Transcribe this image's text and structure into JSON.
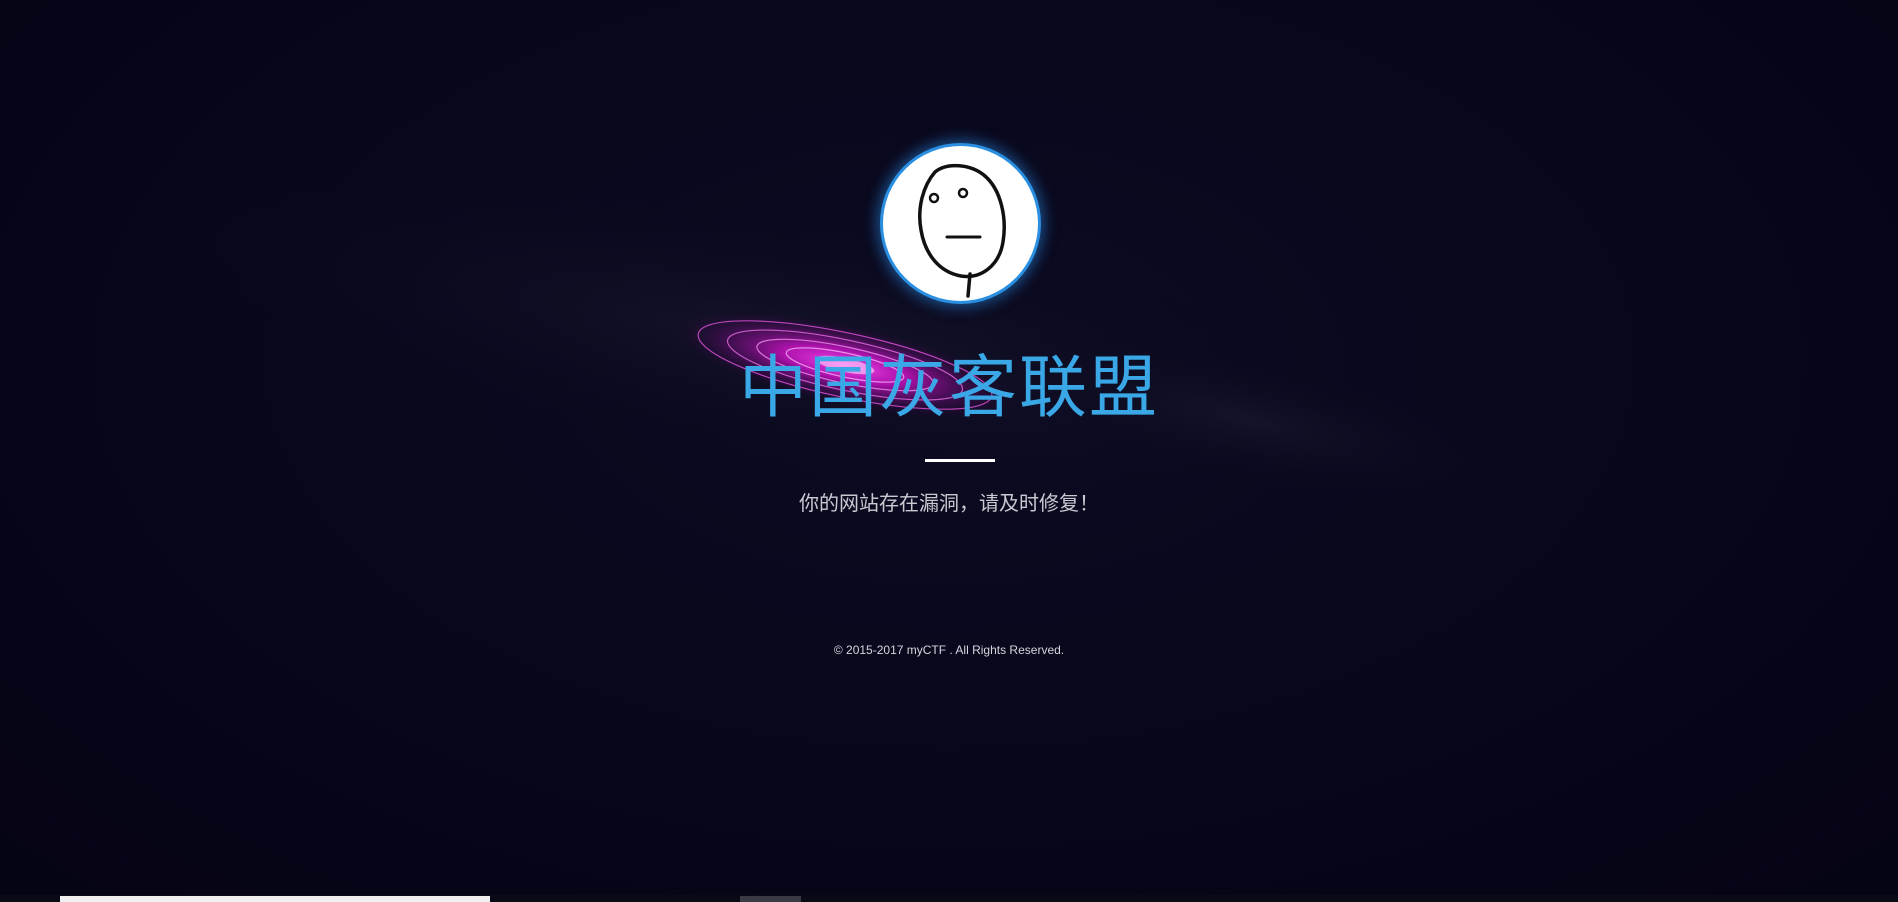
{
  "header": {
    "title": "中国灰客联盟",
    "message": "你的网站存在漏洞，请及时修复！"
  },
  "footer": {
    "copyright": "© 2015-2017 myCTF . All Rights Reserved."
  },
  "colors": {
    "background": "#07061a",
    "title": "#3aa7e6",
    "avatar_border": "#2a8fe0",
    "galaxy": "#ff1cf0"
  },
  "icons": {
    "avatar": "poker-face-meme-icon"
  }
}
